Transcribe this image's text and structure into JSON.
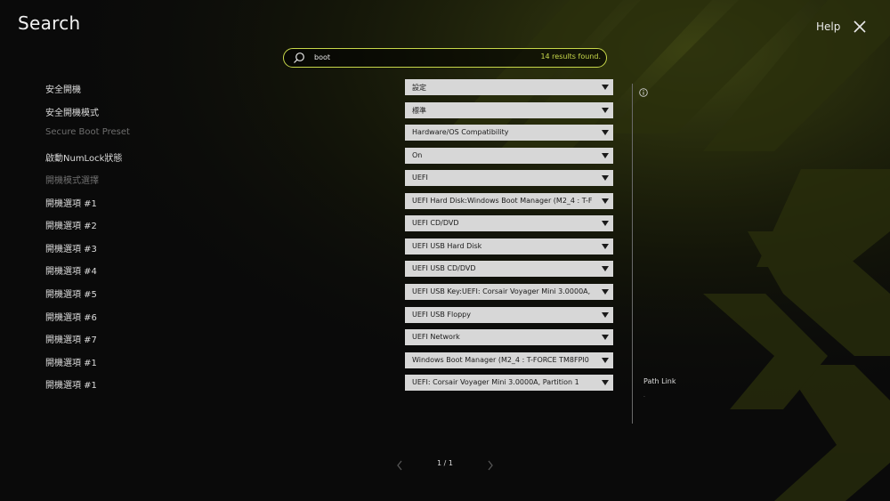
{
  "header": {
    "title": "Search",
    "help_label": "Help"
  },
  "search": {
    "value": "boot",
    "result_count": "14 results found."
  },
  "rows": [
    {
      "label": "安全開機",
      "value": "設定",
      "dim": false
    },
    {
      "label": "安全開機模式",
      "value": "標準",
      "dim": false
    },
    {
      "label": "Secure Boot Preset",
      "value": "Hardware/OS Compatibility",
      "dim": true
    },
    {
      "label": "啟動NumLock狀態",
      "value": "On",
      "dim": false
    },
    {
      "label": "開機模式選擇",
      "value": "UEFI",
      "dim": true
    },
    {
      "label": "開機選項 #1",
      "value": "UEFI Hard Disk:Windows Boot Manager (M2_4 : T-F",
      "dim": false
    },
    {
      "label": "開機選項 #2",
      "value": "UEFI CD/DVD",
      "dim": false
    },
    {
      "label": "開機選項 #3",
      "value": "UEFI USB Hard Disk",
      "dim": false
    },
    {
      "label": "開機選項 #4",
      "value": "UEFI USB CD/DVD",
      "dim": false
    },
    {
      "label": "開機選項 #5",
      "value": "UEFI USB Key:UEFI: Corsair Voyager Mini 3.0000A,",
      "dim": false
    },
    {
      "label": "開機選項 #6",
      "value": "UEFI USB Floppy",
      "dim": false
    },
    {
      "label": "開機選項 #7",
      "value": "UEFI Network",
      "dim": false
    },
    {
      "label": "開機選項 #1",
      "value": "Windows Boot Manager (M2_4 : T-FORCE TM8FPI0",
      "dim": false
    },
    {
      "label": "開機選項 #1",
      "value": "UEFI: Corsair Voyager Mini 3.0000A, Partition 1",
      "dim": false
    }
  ],
  "side_panel": {
    "path_link_label": "Path Link",
    "path_value": "."
  },
  "pagination": {
    "text": "1 / 1"
  },
  "colors": {
    "accent": "#c8d84a",
    "background": "#0a0a0a",
    "dropdown_bg": "#d7d7d7"
  },
  "icons": {
    "close": "close-icon",
    "search": "search-icon",
    "info": "info-icon",
    "prev": "chevron-left-icon",
    "next": "chevron-right-icon",
    "dropdown": "caret-down-icon"
  }
}
